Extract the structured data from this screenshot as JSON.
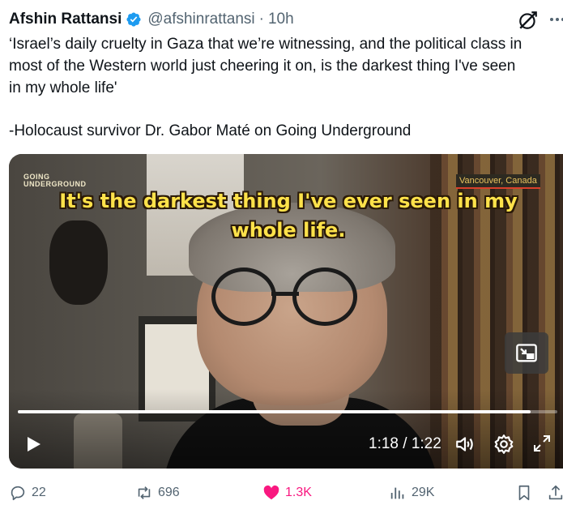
{
  "author": {
    "name": "Afshin Rattansi",
    "handle": "@afshinrattansi",
    "separator": "·",
    "time": "10h"
  },
  "tweet": {
    "lines": [
      "‘Israel’s daily cruelty in Gaza that we’re witnessing, and the political class in",
      "most of the Western world just cheering it on, is the darkest thing I've seen",
      "in my whole life'",
      "-Holocaust survivor Dr. Gabor Maté on Going Underground"
    ]
  },
  "video": {
    "logo_line1": "GOING",
    "logo_line2": "UNDERGROUND",
    "location": "Vancouver, Canada",
    "caption_line1": "It's the darkest thing I've ever seen in my",
    "caption_line2": "whole life.",
    "time_display": "1:18 / 1:22",
    "progress_fraction": 0.95
  },
  "actions": {
    "replies": "22",
    "reposts": "696",
    "likes": "1.3K",
    "views": "29K"
  },
  "colors": {
    "like": "#f91880",
    "verified": "#1d9bf0",
    "muted": "#536471",
    "caption": "#ffe24a"
  },
  "icons": [
    "verified-badge-icon",
    "grok-icon",
    "more-icon",
    "pip-icon",
    "play-icon",
    "volume-icon",
    "settings-icon",
    "fullscreen-icon",
    "reply-icon",
    "repost-icon",
    "like-icon",
    "views-icon",
    "bookmark-icon",
    "share-icon"
  ]
}
